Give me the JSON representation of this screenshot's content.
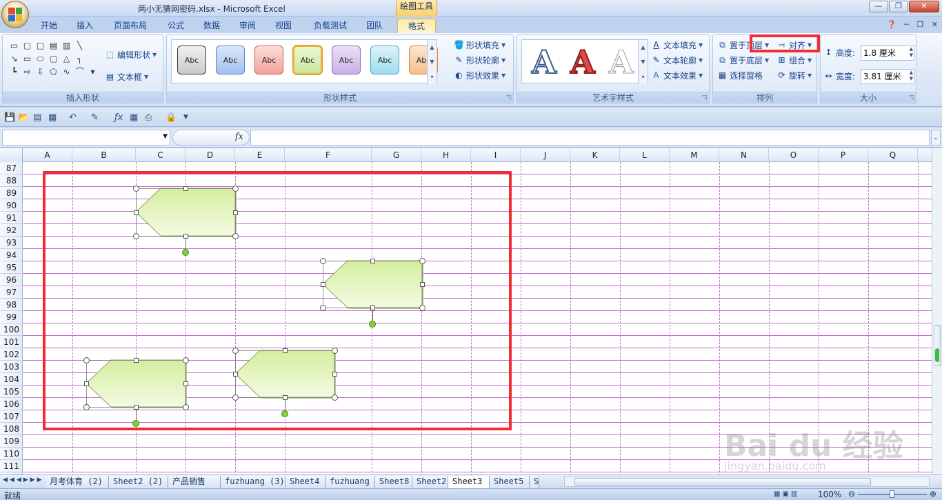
{
  "window": {
    "title": "两小无猜网密码.xlsx - Microsoft Excel",
    "context_tool": "绘图工具"
  },
  "tabs": [
    {
      "label": "开始"
    },
    {
      "label": "插入"
    },
    {
      "label": "页面布局"
    },
    {
      "label": "公式"
    },
    {
      "label": "数据"
    },
    {
      "label": "审阅"
    },
    {
      "label": "视图"
    },
    {
      "label": "负载测试"
    },
    {
      "label": "团队"
    },
    {
      "label": "格式"
    }
  ],
  "ribbon": {
    "insert_shapes": {
      "edit_shape": "编辑形状",
      "text_box": "文本框",
      "label": "插入形状"
    },
    "shape_styles": {
      "sample": "Abc",
      "fill": "形状填充",
      "outline": "形状轮廓",
      "effects": "形状效果",
      "label": "形状样式"
    },
    "wordart": {
      "letter": "A",
      "fill": "文本填充",
      "outline": "文本轮廓",
      "effects": "文本效果",
      "label": "艺术字样式"
    },
    "arrange": {
      "bring_front": "置于顶层",
      "send_back": "置于底层",
      "selection_pane": "选择窗格",
      "align": "对齐",
      "group": "组合",
      "rotate": "旋转",
      "label": "排列"
    },
    "size": {
      "height_label": "高度:",
      "height_value": "1.8 厘米",
      "width_label": "宽度:",
      "width_value": "3.81 厘米",
      "label": "大小"
    }
  },
  "formula_bar": {
    "fx": "fx"
  },
  "columns": [
    "A",
    "B",
    "C",
    "D",
    "E",
    "F",
    "G",
    "H",
    "I",
    "J",
    "K",
    "L",
    "M",
    "N",
    "O",
    "P",
    "Q"
  ],
  "rows": [
    "87",
    "88",
    "89",
    "90",
    "91",
    "92",
    "93",
    "94",
    "95",
    "96",
    "97",
    "98",
    "99",
    "100",
    "101",
    "102",
    "103",
    "104",
    "105",
    "106",
    "107",
    "108",
    "109",
    "110",
    "111"
  ],
  "sheet_tabs": [
    {
      "label": "月考体育 (2)"
    },
    {
      "label": "Sheet2 (2)"
    },
    {
      "label": "产品销售"
    },
    {
      "label": "fuzhuang (3)"
    },
    {
      "label": "Sheet4"
    },
    {
      "label": "fuzhuang"
    },
    {
      "label": "Sheet8"
    },
    {
      "label": "Sheet2"
    },
    {
      "label": "Sheet3"
    },
    {
      "label": "Sheet5"
    },
    {
      "label": "S"
    }
  ],
  "status": {
    "ready": "就绪",
    "zoom": "100%"
  },
  "watermark": {
    "text": "Bai du 经验",
    "url": "jingyan.baidu.com"
  },
  "colors": {
    "highlight": "#ee2e34",
    "grid_line": "#c46bd0",
    "shape_fill": "#e6f5c3",
    "shape_stroke": "#8aa65a"
  }
}
